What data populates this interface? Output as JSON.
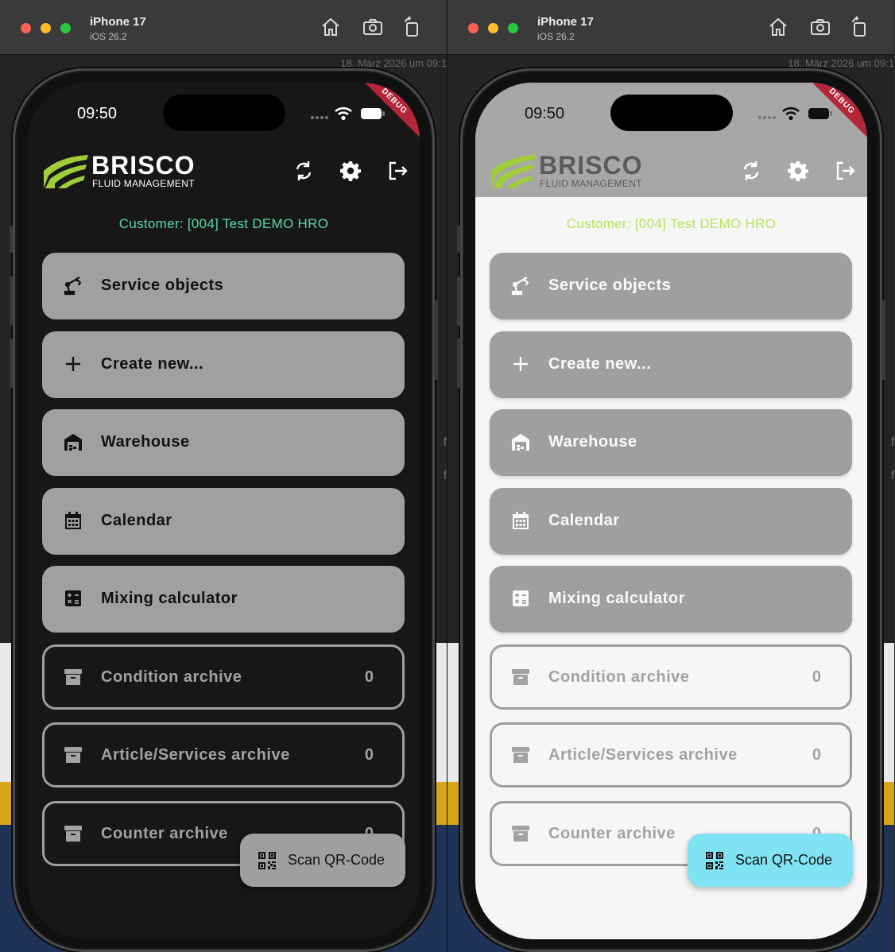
{
  "simulators": [
    {
      "theme": "dark",
      "device_name": "iPhone 17",
      "os_version": "iOS 26.2",
      "date_peek": "18. März 2026 um 09:1",
      "status_time": "09:50",
      "debug_label": "DEBUG",
      "brand_name": "BRISCO",
      "brand_subtitle": "FLUID MANAGEMENT",
      "customer_label": "Customer: [004] Test DEMO HRO",
      "menu": [
        {
          "label": "Service objects",
          "icon": "robot-arm-icon",
          "style": "filled"
        },
        {
          "label": "Create new...",
          "icon": "plus-icon",
          "style": "filled"
        },
        {
          "label": "Warehouse",
          "icon": "warehouse-icon",
          "style": "filled"
        },
        {
          "label": "Calendar",
          "icon": "calendar-icon",
          "style": "filled"
        },
        {
          "label": "Mixing calculator",
          "icon": "calculator-icon",
          "style": "filled"
        },
        {
          "label": "Condition archive",
          "icon": "archive-icon",
          "style": "outlined",
          "count": "0"
        },
        {
          "label": "Article/Services archive",
          "icon": "archive-icon",
          "style": "outlined",
          "count": "0"
        },
        {
          "label": "Counter archive",
          "icon": "archive-icon",
          "style": "outlined",
          "count": "0"
        }
      ],
      "fab_label": "Scan QR-Code",
      "colors": {
        "customer": "#59d7a4",
        "button_fill": "#a0a0a0",
        "fab": "#9f9f9f"
      }
    },
    {
      "theme": "light",
      "device_name": "iPhone 17",
      "os_version": "iOS 26.2",
      "date_peek": "18. März 2026 um 09:1",
      "status_time": "09:50",
      "debug_label": "DEBUG",
      "brand_name": "BRISCO",
      "brand_subtitle": "FLUID MANAGEMENT",
      "customer_label": "Customer: [004] Test DEMO HRO",
      "menu": [
        {
          "label": "Service objects",
          "icon": "robot-arm-icon",
          "style": "filled"
        },
        {
          "label": "Create new...",
          "icon": "plus-icon",
          "style": "filled"
        },
        {
          "label": "Warehouse",
          "icon": "warehouse-icon",
          "style": "filled"
        },
        {
          "label": "Calendar",
          "icon": "calendar-icon",
          "style": "filled"
        },
        {
          "label": "Mixing calculator",
          "icon": "calculator-icon",
          "style": "filled"
        },
        {
          "label": "Condition archive",
          "icon": "archive-icon",
          "style": "outlined",
          "count": "0"
        },
        {
          "label": "Article/Services archive",
          "icon": "archive-icon",
          "style": "outlined",
          "count": "0"
        },
        {
          "label": "Counter archive",
          "icon": "archive-icon",
          "style": "outlined",
          "count": "0"
        }
      ],
      "fab_label": "Scan QR-Code",
      "colors": {
        "customer": "#b7e35e",
        "button_fill": "#9f9f9f",
        "fab": "#7fe3f3"
      }
    }
  ]
}
